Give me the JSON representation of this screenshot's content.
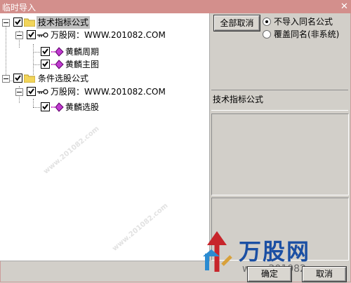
{
  "window": {
    "title": "临时导入",
    "close_glyph": "✕"
  },
  "tree": {
    "groups": [
      {
        "label": "技术指标公式",
        "source": "万股网：WWW.201082.COM",
        "items": [
          "黄麟周期",
          "黄麟主图"
        ]
      },
      {
        "label": "条件选股公式",
        "source": "万股网：WWW.201082.COM",
        "items": [
          "黄麟选股"
        ]
      }
    ]
  },
  "controls": {
    "deselect_all_label": "全部取消",
    "radio_options": [
      {
        "label": "不导入同名公式",
        "checked": true
      },
      {
        "label": "覆盖同名(非系统)",
        "checked": false
      }
    ],
    "selected_type_label": "技术指标公式",
    "ok_label": "确定",
    "cancel_label": "取消"
  },
  "watermark": {
    "brand": "万股网",
    "url": "www.201082.com"
  },
  "colors": {
    "titlebar": "#d38f8c",
    "panel": "#d2cfc9",
    "selection": "#c0c0c0"
  }
}
